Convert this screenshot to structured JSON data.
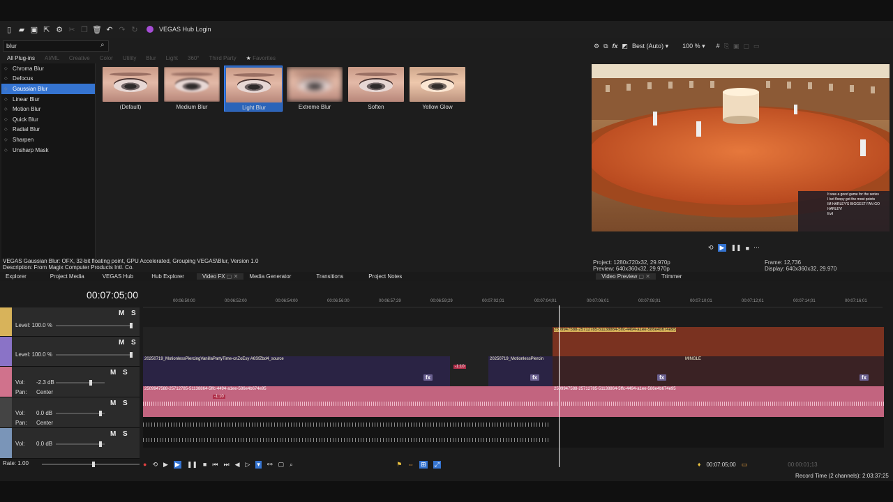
{
  "toolbar": {
    "hub_label": "VEGAS Hub Login"
  },
  "search": {
    "value": "blur"
  },
  "categories": [
    "All Plug-ins",
    "AI/ML",
    "Creative",
    "Color",
    "Utility",
    "Blur",
    "Light",
    "360°",
    "Third Party",
    "Favorites"
  ],
  "plugins": [
    "Chroma Blur",
    "Defocus",
    "Gaussian Blur",
    "Linear Blur",
    "Motion Blur",
    "Quick Blur",
    "Radial Blur",
    "Sharpen",
    "Unsharp Mask"
  ],
  "presets": [
    "(Default)",
    "Medium Blur",
    "Light Blur",
    "Extreme Blur",
    "Soften",
    "Yellow Glow"
  ],
  "description": {
    "line1": "VEGAS Gaussian Blur: OFX, 32-bit floating point, GPU Accelerated, Grouping VEGAS\\Blur, Version 1.0",
    "line2": "Description: From Magix Computer Products Intl. Co."
  },
  "preview": {
    "quality": "Best (Auto)",
    "zoom": "100 %",
    "project": "Project:  1280x720x32, 29.970p",
    "preview_res": "Preview:  640x360x32, 29.970p",
    "frame": "Frame:       12,736",
    "display": "Display:    640x360x32, 29.970",
    "chat1": "It was a good game for the series",
    "chat2": "I bet floopy got the most points",
    "chat3": "IM HARLEY'S BIGGEST FAN GO HARLEY!",
    "chat4": "Evil"
  },
  "tabs": [
    "Explorer",
    "Project Media",
    "VEGAS Hub",
    "Hub Explorer",
    "Video FX",
    "Media Generator",
    "Transitions",
    "Project Notes",
    "Video Preview",
    "Trimmer"
  ],
  "timeline": {
    "timecode": "00:07:05;00",
    "ticks": [
      "00:06:50:00",
      "00:06:52:00",
      "00:06:54:00",
      "00:06:56:00",
      "00:06:57;29",
      "00:06:59;29",
      "00:07:02;01",
      "00:07:04;01",
      "00:07:06;01",
      "00:07:08;01",
      "00:07:10;01",
      "00:07:12;01",
      "00:07:14;01",
      "00:07:16;01"
    ],
    "track1_level": "Level: 100.0 %",
    "track2_level": "Level: 100.0 %",
    "audio1_vol": "Vol:",
    "audio1_vol_val": "-2.3 dB",
    "audio1_pan": "Pan:",
    "audio1_pan_val": "Center",
    "audio2_vol": "Vol:",
    "audio2_vol_val": "0.0 dB",
    "audio2_pan": "Pan:",
    "audio2_pan_val": "Center",
    "audio3_vol": "Vol:",
    "audio3_vol_val": "0.0 dB",
    "m": "M",
    "s": "S",
    "clip_video1": "20250719_MotionlessPiercingVanillaPartyTime-cnZoEsy A6SfZbd4_source",
    "clip_video2": "20250719_MotionlessPiercin",
    "clip_video3": "2509947588-25712785-51138864-5ffc-4494-a1ee-586e4b674e95",
    "clip_audio": "2509947588-25712785-51138864-5ffc-4494-a1ee-586e4b674e95",
    "badge": "-1:10",
    "mingle": "MINGLE",
    "rate": "Rate: 1.00",
    "cursor_time": "00:07:05;00",
    "record_time": "Record Time (2 channels): 2:03:37:25",
    "end_time": "00:00:01;13"
  }
}
